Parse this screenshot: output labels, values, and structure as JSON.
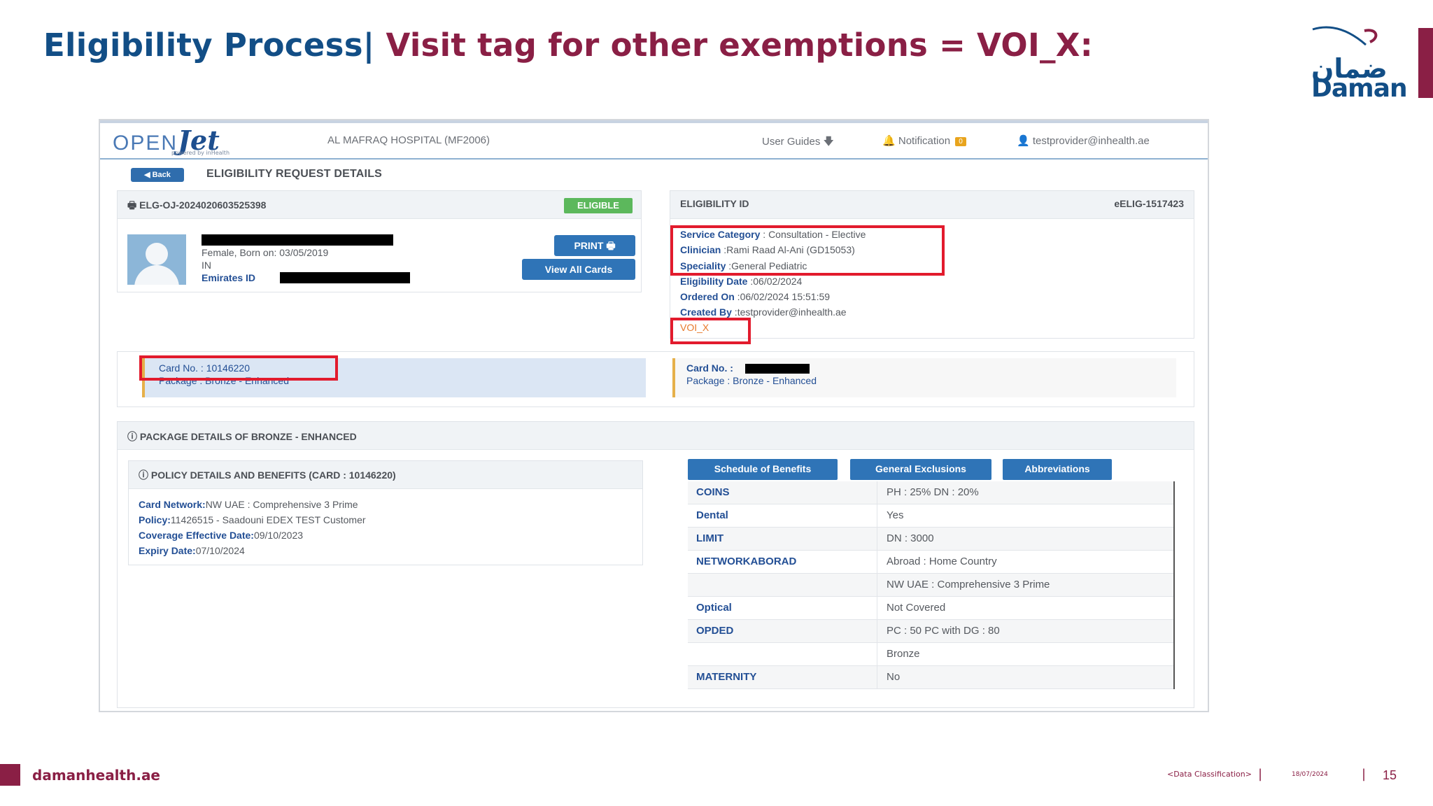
{
  "slide": {
    "title_part1": "Eligibility Process|",
    "title_part2": "Visit tag for other exemptions = VOI_X:",
    "logo_arabic": "ضمان",
    "logo_latin": "Daman",
    "footer_site": "damanhealth.ae",
    "footer_classification": "<Data Classification>",
    "footer_date": "18/07/2024",
    "page_number": "15",
    "colors": {
      "navy": "#124e86",
      "maroon": "#8a1f45",
      "highlight_red": "#e21b2d"
    }
  },
  "app": {
    "brand_open": "OPEN",
    "brand_jet": "Jet",
    "brand_sub": "powered by inHealth",
    "hospital": "AL MAFRAQ HOSPITAL (MF2006)",
    "nav": {
      "user_guides": "User Guides",
      "notification": "Notification",
      "notification_count": "0",
      "user": "testprovider@inhealth.ae"
    },
    "back_label": "Back",
    "page_title": "ELIGIBILITY REQUEST DETAILS"
  },
  "patient": {
    "request_id": "ELG-OJ-2024020603525398",
    "status": "ELIGIBLE",
    "gender_dob": "Female, Born on: 03/05/2019",
    "nationality": "IN",
    "emirates_label": "Emirates ID",
    "print_label": "PRINT",
    "view_cards_label": "View All Cards"
  },
  "eligibility": {
    "header_label": "ELIGIBILITY ID",
    "header_value": "eELIG-1517423",
    "fields": [
      {
        "label": "Service Category",
        "value": " : Consultation - Elective"
      },
      {
        "label": "Clinician",
        "value": " :Rami Raad Al-Ani (GD15053)"
      },
      {
        "label": "Speciality",
        "value": " :General Pediatric"
      },
      {
        "label": "Eligibility Date",
        "value": " :06/02/2024"
      },
      {
        "label": "Ordered On",
        "value": " :06/02/2024 15:51:59"
      },
      {
        "label": "Created By",
        "value": " :testprovider@inhealth.ae"
      }
    ],
    "visit_tag": "VOI_X"
  },
  "cards": {
    "left": {
      "card_no": "Card No. : 10146220",
      "package": "Package : Bronze - Enhanced"
    },
    "right": {
      "card_label": "Card No. :",
      "package": "Package : Bronze - Enhanced"
    }
  },
  "package": {
    "title": "PACKAGE DETAILS OF BRONZE - ENHANCED",
    "policy_title": "POLICY DETAILS AND BENEFITS (CARD : 10146220)",
    "policy_fields": [
      {
        "label": "Card Network:",
        "value": "NW UAE : Comprehensive 3 Prime"
      },
      {
        "label": "Policy:",
        "value": "11426515 - Saadouni EDEX TEST Customer"
      },
      {
        "label": "Coverage Effective Date:",
        "value": "09/10/2023"
      },
      {
        "label": "Expiry Date:",
        "value": "07/10/2024"
      }
    ],
    "buttons": [
      "Schedule of Benefits",
      "General Exclusions",
      "Abbreviations"
    ],
    "benefits": [
      {
        "key": "COINS",
        "value": "PH : 25% DN : 20%"
      },
      {
        "key": "Dental",
        "value": "Yes"
      },
      {
        "key": "LIMIT",
        "value": "DN : 3000"
      },
      {
        "key": "NETWORKABORAD",
        "value": "Abroad : Home Country"
      },
      {
        "key": "",
        "value": "NW UAE : Comprehensive 3 Prime"
      },
      {
        "key": "Optical",
        "value": "Not Covered"
      },
      {
        "key": "OPDED",
        "value": "PC : 50 PC with DG : 80"
      },
      {
        "key": "",
        "value": "Bronze"
      },
      {
        "key": "MATERNITY",
        "value": "No"
      }
    ]
  }
}
